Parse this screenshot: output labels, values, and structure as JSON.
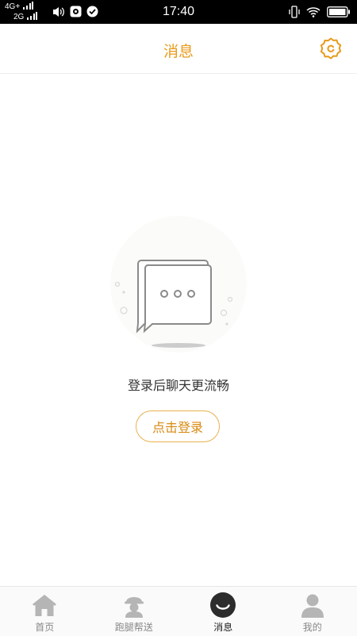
{
  "status_bar": {
    "network_top": "4G+",
    "network_bottom": "2G",
    "time": "17:40"
  },
  "header": {
    "title": "消息",
    "settings_icon": "settings-gear-icon",
    "accent_color": "#e99a1a"
  },
  "empty_state": {
    "illustration_icon": "chat-bubbles-icon",
    "message": "登录后聊天更流畅",
    "login_label": "点击登录"
  },
  "tabbar": {
    "tabs": [
      {
        "label": "首页",
        "icon": "home-icon",
        "active": false
      },
      {
        "label": "跑腿帮送",
        "icon": "courier-icon",
        "active": false
      },
      {
        "label": "消息",
        "icon": "message-smile-icon",
        "active": true
      },
      {
        "label": "我的",
        "icon": "user-icon",
        "active": false
      }
    ]
  }
}
